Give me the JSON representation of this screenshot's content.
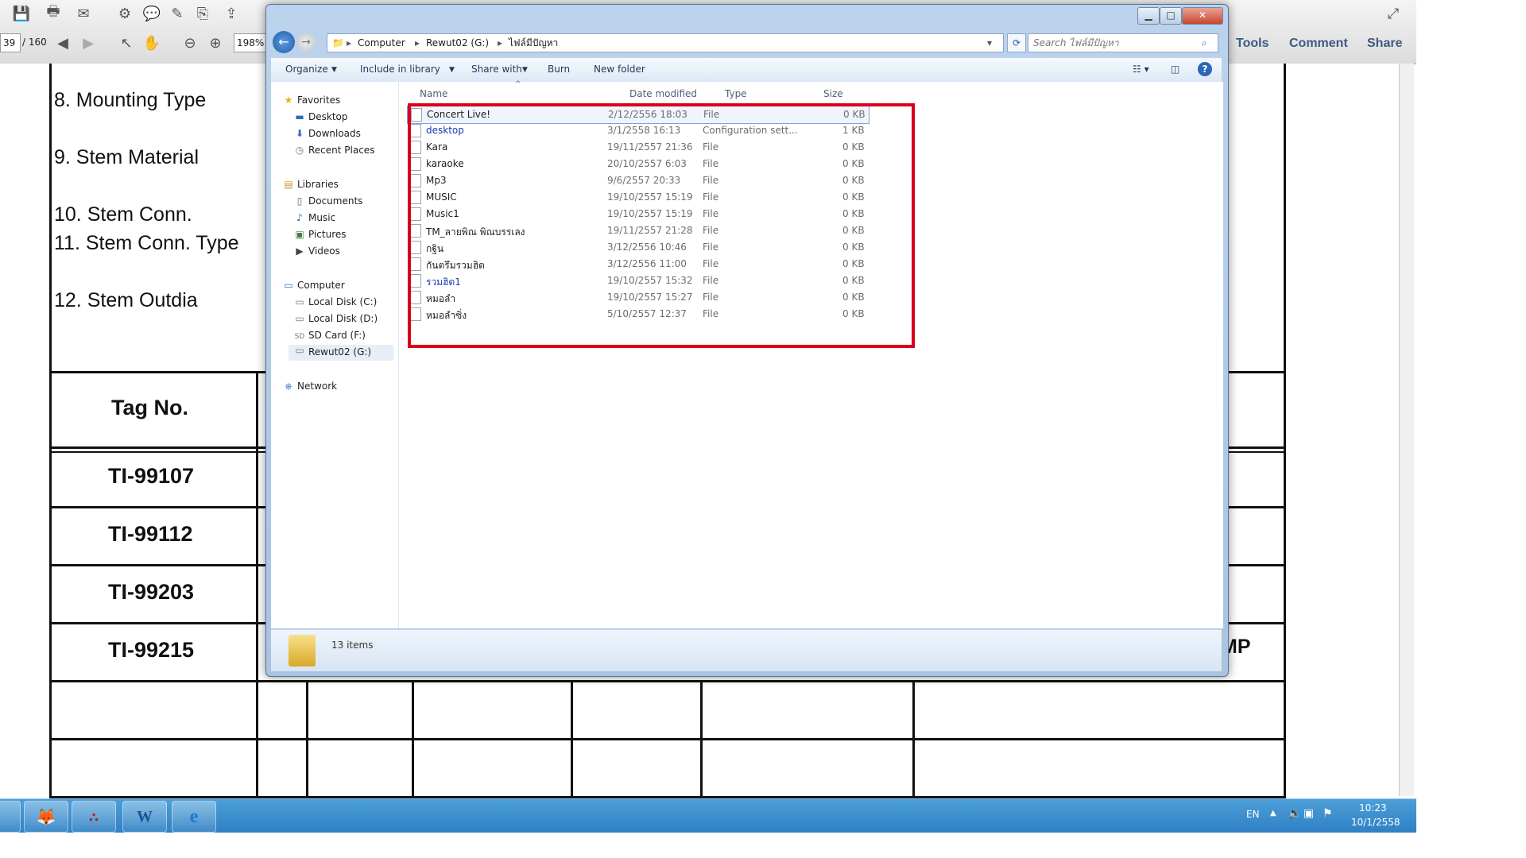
{
  "acrobat": {
    "page_current": "39",
    "page_total": "/ 160",
    "zoom": "198%",
    "tabs": [
      "Tools",
      "Comment",
      "Share"
    ]
  },
  "document": {
    "labels": [
      "8. Mounting Type",
      "9. Stem Material",
      "10. Stem Conn.",
      "11. Stem Conn. Type",
      "12. Stem Outdia"
    ],
    "tag_header": "Tag No.",
    "tags": [
      "TI-99107",
      "TI-99112",
      "TI-99203",
      "TI-99215"
    ],
    "partial_right_text": "MP"
  },
  "explorer": {
    "breadcrumb": [
      "Computer",
      "Rewut02 (G:)",
      "ไฟล์มีปัญหา"
    ],
    "search_placeholder": "Search ไฟล์มีปัญหา",
    "commands": [
      "Organize",
      "Include in library",
      "Share with",
      "Burn",
      "New folder"
    ],
    "nav": {
      "favorites_header": "Favorites",
      "favorites": [
        "Desktop",
        "Downloads",
        "Recent Places"
      ],
      "libraries_header": "Libraries",
      "libraries": [
        "Documents",
        "Music",
        "Pictures",
        "Videos"
      ],
      "computer_header": "Computer",
      "drives": [
        "Local Disk (C:)",
        "Local Disk (D:)",
        "SD Card (F:)",
        "Rewut02 (G:)"
      ],
      "network": "Network"
    },
    "columns": [
      "Name",
      "Date modified",
      "Type",
      "Size"
    ],
    "files": [
      {
        "name": "Concert Live!",
        "date": "2/12/2556 18:03",
        "type": "File",
        "size": "0 KB"
      },
      {
        "name": "desktop",
        "date": "3/1/2558 16:13",
        "type": "Configuration sett...",
        "size": "1 KB"
      },
      {
        "name": "Kara",
        "date": "19/11/2557 21:36",
        "type": "File",
        "size": "0 KB"
      },
      {
        "name": "karaoke",
        "date": "20/10/2557 6:03",
        "type": "File",
        "size": "0 KB"
      },
      {
        "name": "Mp3",
        "date": "9/6/2557 20:33",
        "type": "File",
        "size": "0 KB"
      },
      {
        "name": "MUSIC",
        "date": "19/10/2557 15:19",
        "type": "File",
        "size": "0 KB"
      },
      {
        "name": "Music1",
        "date": "19/10/2557 15:19",
        "type": "File",
        "size": "0 KB"
      },
      {
        "name": "TM_ลายพิณ พิณบรรเลง",
        "date": "19/11/2557 21:28",
        "type": "File",
        "size": "0 KB"
      },
      {
        "name": "กฐิน",
        "date": "3/12/2556 10:46",
        "type": "File",
        "size": "0 KB"
      },
      {
        "name": "กันตรึมรวมฮิต",
        "date": "3/12/2556 11:00",
        "type": "File",
        "size": "0 KB"
      },
      {
        "name": "รวมฮิต1",
        "date": "19/10/2557 15:32",
        "type": "File",
        "size": "0 KB"
      },
      {
        "name": "หมอลำ",
        "date": "19/10/2557 15:27",
        "type": "File",
        "size": "0 KB"
      },
      {
        "name": "หมอลำซิ่ง",
        "date": "5/10/2557 12:37",
        "type": "File",
        "size": "0 KB"
      }
    ],
    "status": "13 items"
  },
  "taskbar": {
    "language": "EN",
    "time": "10:23",
    "date": "10/1/2558"
  },
  "colors": {
    "highlight": "#d8001c",
    "taskbar": "#2f80c5",
    "link_text": "#1a3cb0"
  }
}
